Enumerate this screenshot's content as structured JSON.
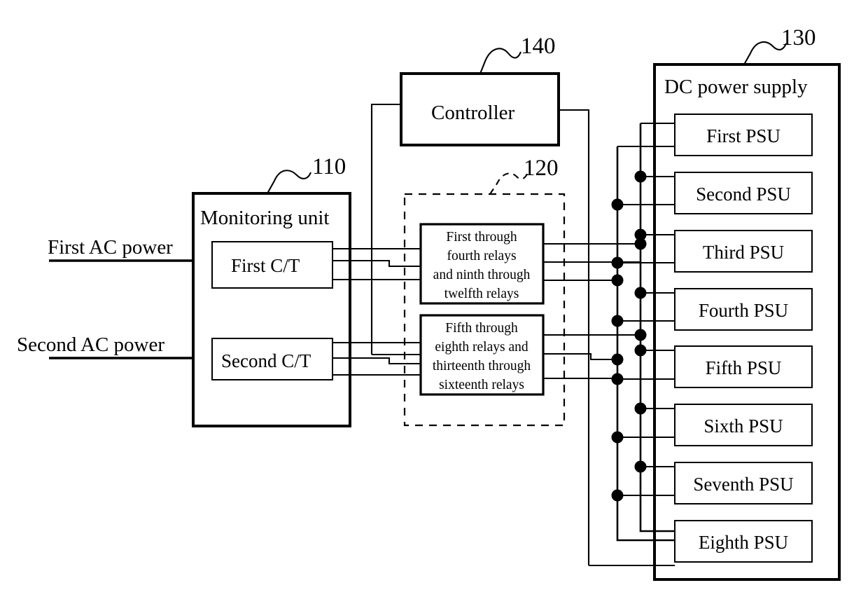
{
  "figure": {
    "type": "patent-block-diagram",
    "background_color": "#ffffff",
    "line_color": "#000000"
  },
  "inputs": {
    "first_ac": "First AC power",
    "second_ac": "Second AC power"
  },
  "monitoring_unit": {
    "ref": "110",
    "title": "Monitoring unit",
    "sensors": [
      {
        "label": "First C/T"
      },
      {
        "label": "Second C/T"
      }
    ]
  },
  "relay_unit": {
    "ref": "120",
    "boxes": [
      {
        "lines": [
          "First through",
          "fourth relays",
          "and ninth through",
          "twelfth relays"
        ]
      },
      {
        "lines": [
          "Fifth through",
          "eighth relays and",
          "thirteenth through",
          "sixteenth relays"
        ]
      }
    ]
  },
  "controller": {
    "ref": "140",
    "title": "Controller"
  },
  "dc_power_supply": {
    "ref": "130",
    "title": "DC power supply",
    "psus": [
      {
        "label": "First PSU"
      },
      {
        "label": "Second PSU"
      },
      {
        "label": "Third PSU"
      },
      {
        "label": "Fourth PSU"
      },
      {
        "label": "Fifth PSU"
      },
      {
        "label": "Sixth PSU"
      },
      {
        "label": "Seventh PSU"
      },
      {
        "label": "Eighth PSU"
      }
    ]
  }
}
